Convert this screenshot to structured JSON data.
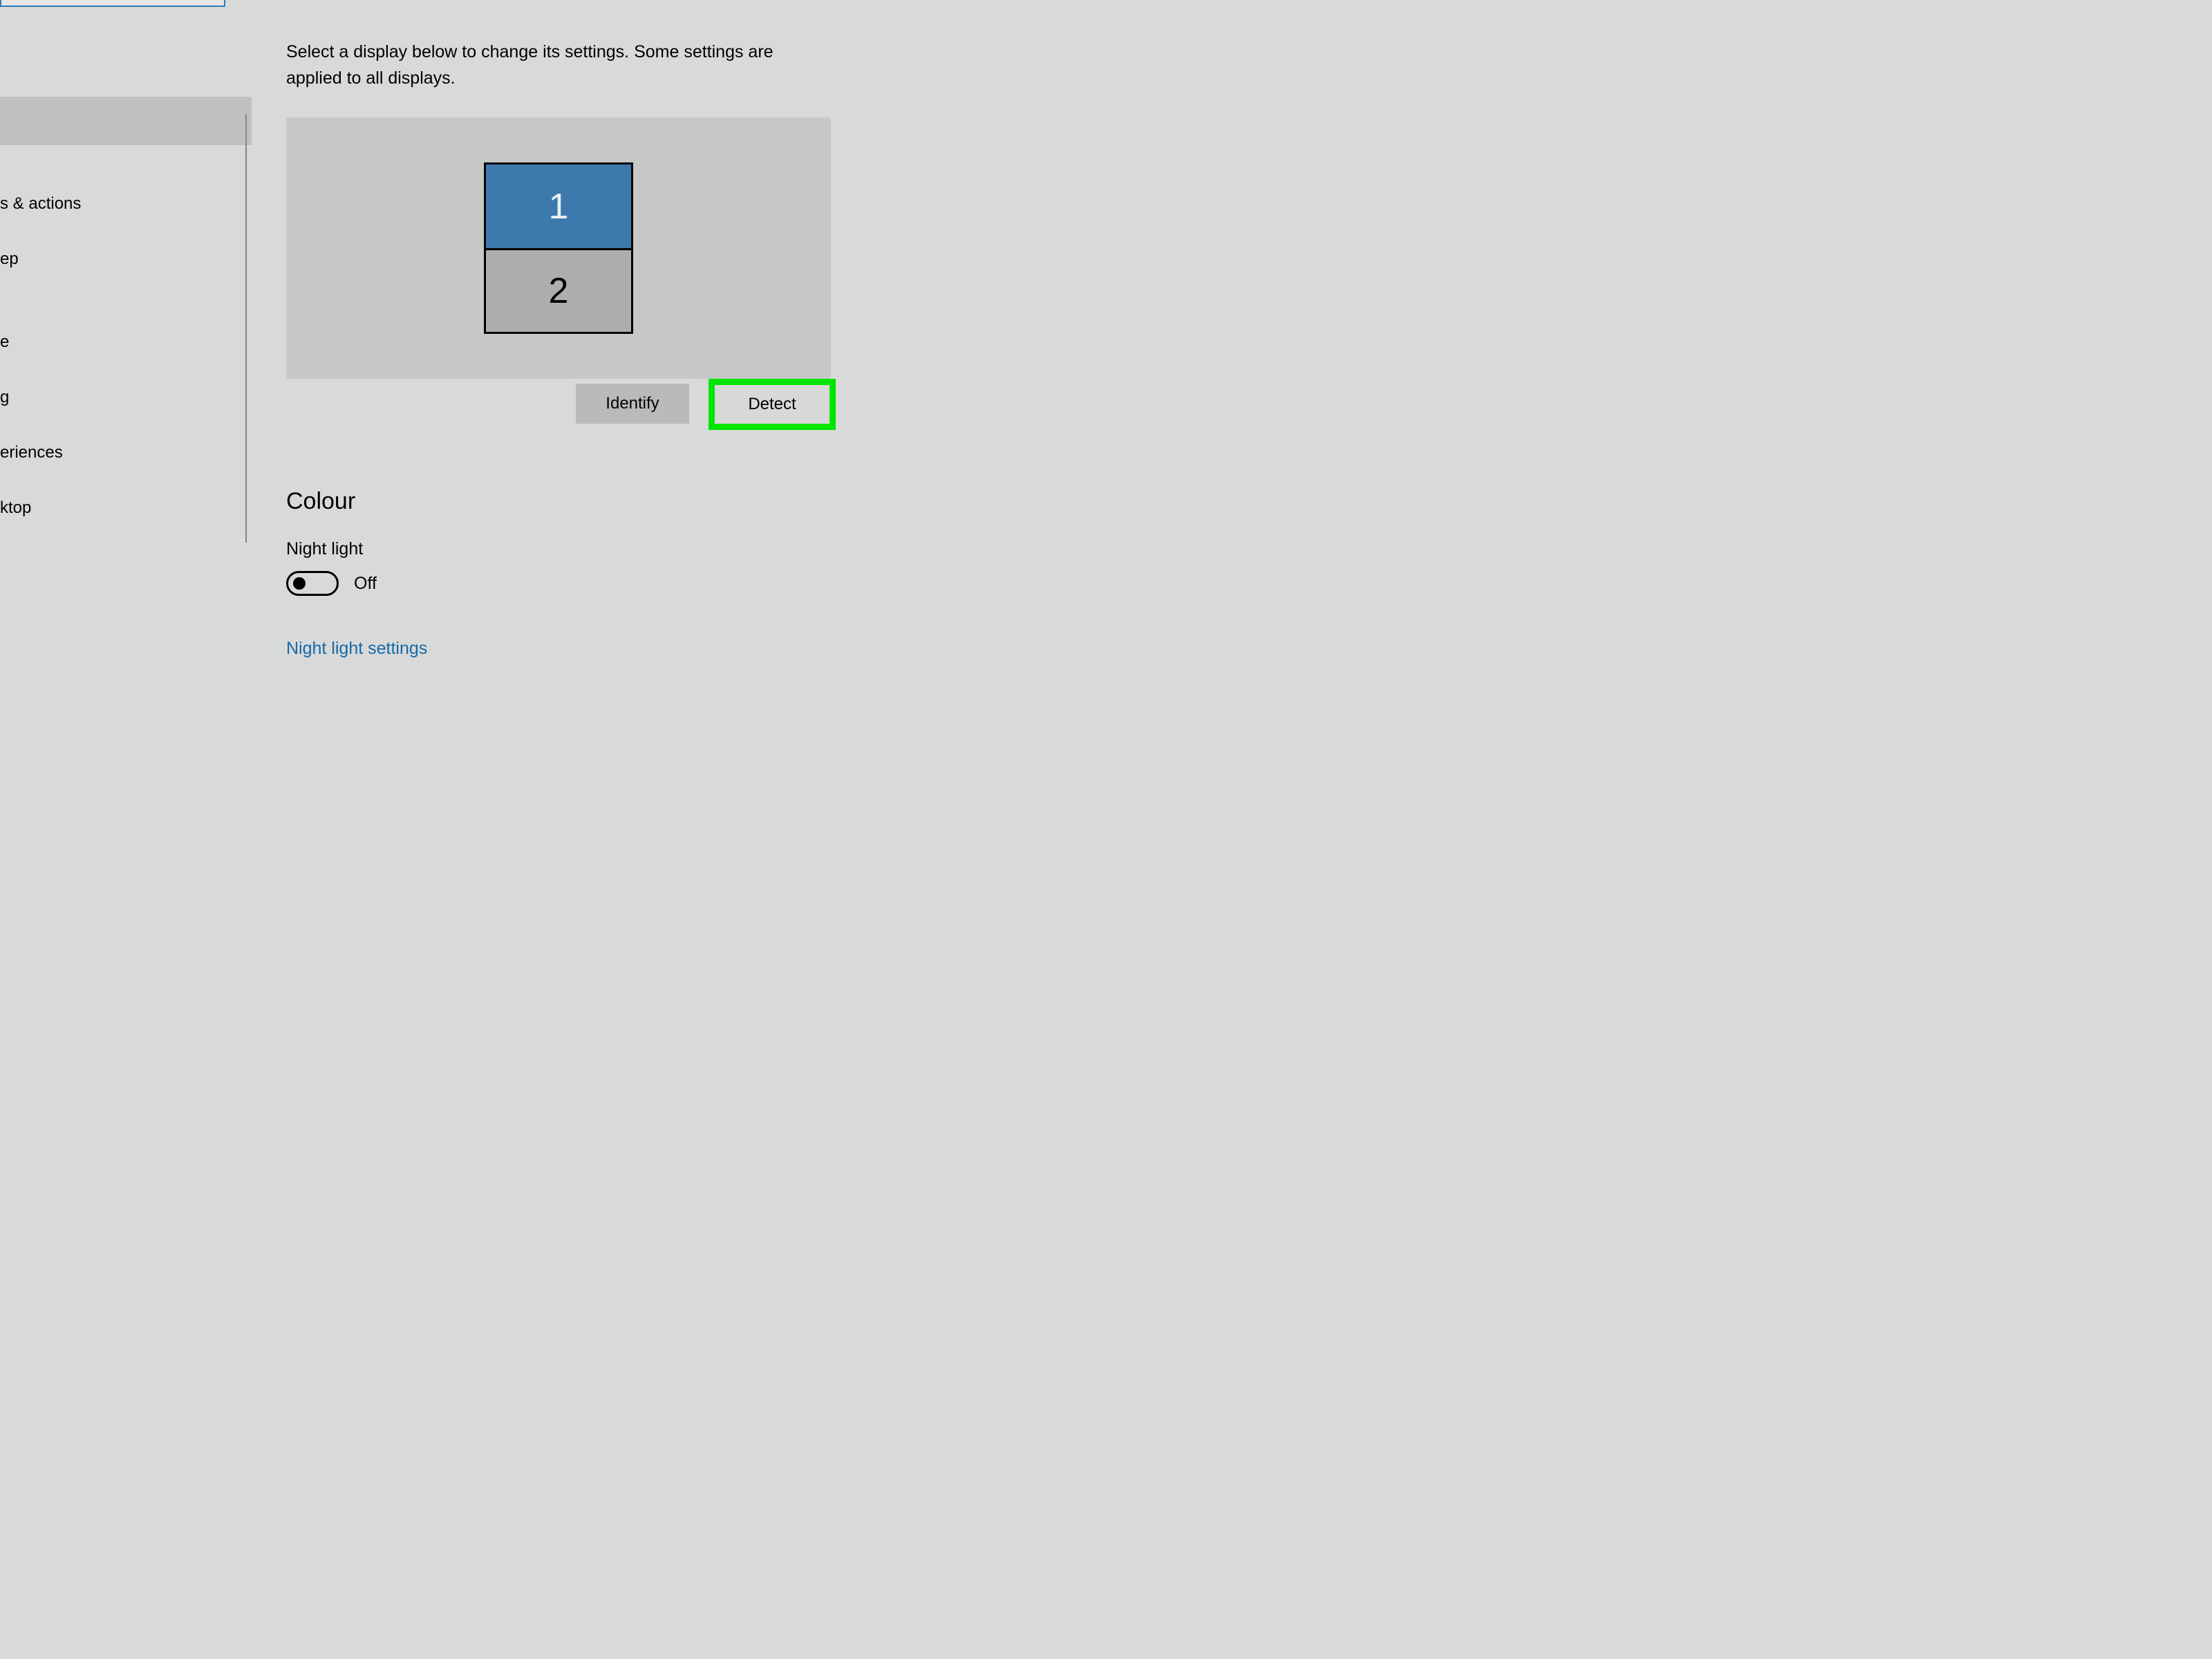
{
  "sidebar": {
    "items": [
      {
        "label": "s & actions"
      },
      {
        "label": "ep"
      },
      {
        "label": "e"
      },
      {
        "label": "g"
      },
      {
        "label": "eriences"
      },
      {
        "label": "ktop"
      }
    ]
  },
  "main": {
    "description": "Select a display below to change its settings. Some settings are applied to all displays.",
    "displays": {
      "primary_label": "1",
      "secondary_label": "2"
    },
    "buttons": {
      "identify": "Identify",
      "detect": "Detect"
    },
    "colour": {
      "heading": "Colour",
      "night_light_label": "Night light",
      "night_light_state": "Off",
      "night_light_settings_link": "Night light settings"
    }
  }
}
